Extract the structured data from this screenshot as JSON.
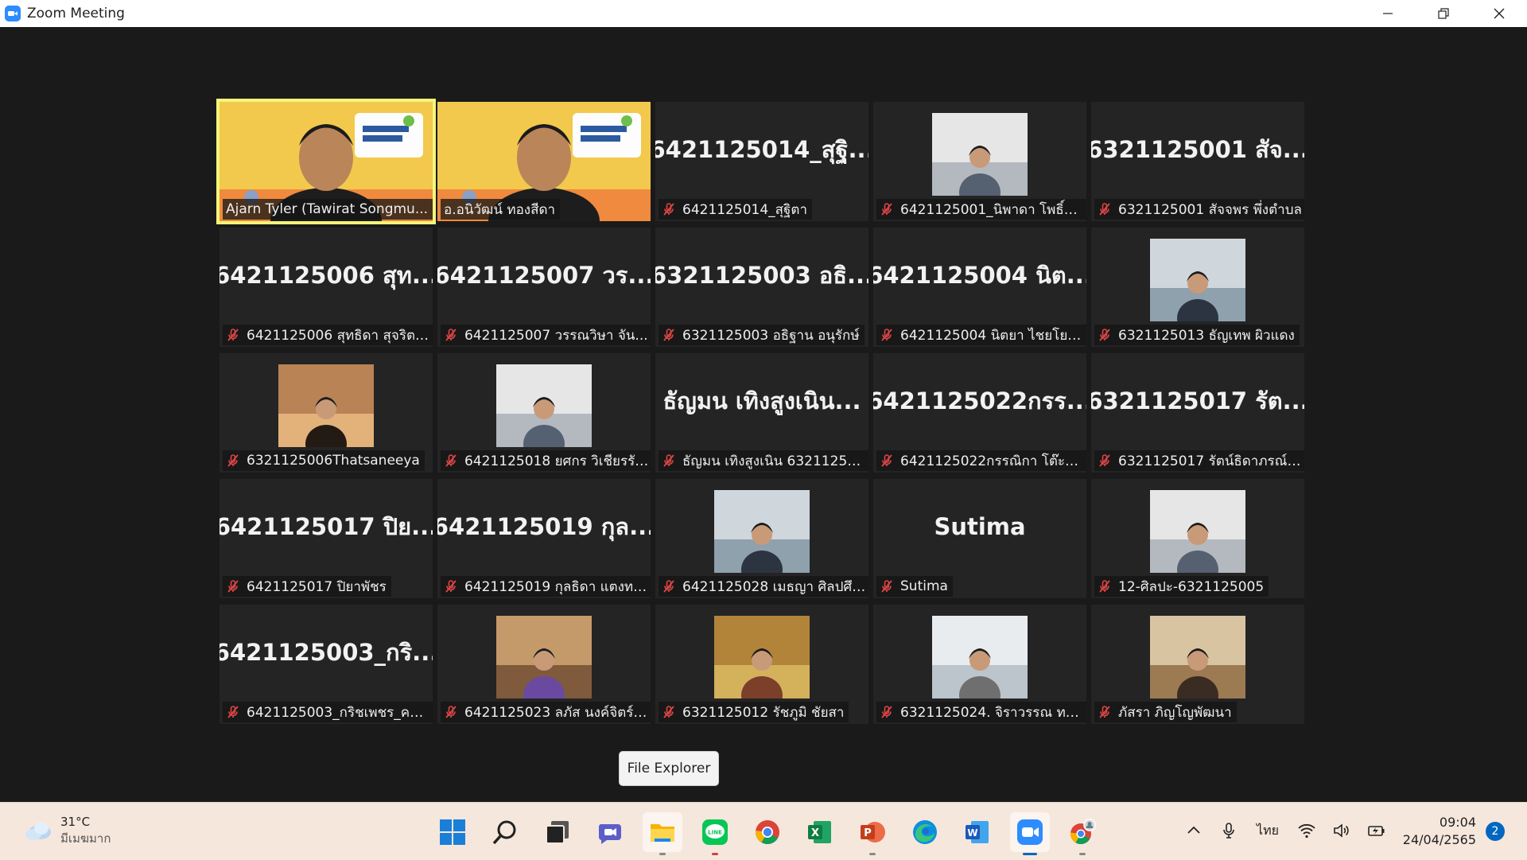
{
  "window": {
    "title": "Zoom Meeting",
    "controls": [
      "minimize",
      "restore",
      "close"
    ]
  },
  "participants": [
    {
      "name_tile": "",
      "label": "Ajarn Tyler (Tawirat Songmu...",
      "video": "camera",
      "speaking": true,
      "muted": false
    },
    {
      "name_tile": "",
      "label": "อ.อนิวัฒน์ ทองสีดา",
      "video": "camera",
      "speaking": false,
      "muted": false
    },
    {
      "name_tile": "6421125014_สุฐิ...",
      "label": "6421125014_สุฐิตา",
      "video": "off",
      "muted": true
    },
    {
      "name_tile": "",
      "label": "6421125001_นิพาดา โพธิ์บุ...",
      "video": "photo",
      "muted": true
    },
    {
      "name_tile": "6321125001 สัจ...",
      "label": "6321125001 สัจจพร พึ่งตำบล",
      "video": "off",
      "muted": true
    },
    {
      "name_tile": "6421125006 สุท...",
      "label": "6421125006 สุทธิดา สุจริต ...",
      "video": "off",
      "muted": true
    },
    {
      "name_tile": "6421125007 วร...",
      "label": "6421125007 วรรณวิษา  จัน...",
      "video": "off",
      "muted": true
    },
    {
      "name_tile": "6321125003 อธิ...",
      "label": "6321125003 อธิฐาน อนุรักษ์",
      "video": "off",
      "muted": true
    },
    {
      "name_tile": "6421125004 นิต...",
      "label": "6421125004 นิตยา ไชยโย ศี...",
      "video": "off",
      "muted": true
    },
    {
      "name_tile": "",
      "label": "6321125013 ธัญเทพ ผิวแดง",
      "video": "photo",
      "muted": true
    },
    {
      "name_tile": "",
      "label": "6321125006Thatsaneeya",
      "video": "photo",
      "muted": true
    },
    {
      "name_tile": "",
      "label": "6421125018 ยศกร วิเชียรรัตน์",
      "video": "photo",
      "muted": true
    },
    {
      "name_tile": "ธัญมน เทิงสูงเนิน...",
      "label": "ธัญมน เทิงสูงเนิน 6321125022",
      "video": "off",
      "muted": true
    },
    {
      "name_tile": "6421125022กรร...",
      "label": "6421125022กรรณิกา โต๊ะห...",
      "video": "off",
      "muted": true
    },
    {
      "name_tile": "6321125017  รัต...",
      "label": "6321125017  รัตน์ธิดาภรณ์ ...",
      "video": "off",
      "muted": true
    },
    {
      "name_tile": "6421125017 ปิย...",
      "label": "6421125017 ปิยาพัชร",
      "video": "off",
      "muted": true
    },
    {
      "name_tile": "6421125019 กุล...",
      "label": "6421125019 กุลธิดา แตงทรั...",
      "video": "off",
      "muted": true
    },
    {
      "name_tile": "",
      "label": "6421125028 เมธญา ศิลปศึก...",
      "video": "photo",
      "muted": true
    },
    {
      "name_tile": "Sutima",
      "label": "Sutima",
      "video": "off",
      "muted": true
    },
    {
      "name_tile": "",
      "label": "12-ศิลปะ-6321125005",
      "video": "photo",
      "muted": true
    },
    {
      "name_tile": "6421125003_กริ...",
      "label": "6421125003_กริชเพชร_คช...",
      "video": "off",
      "muted": true
    },
    {
      "name_tile": "",
      "label": "6421125023 ลภัส นงค์จิตร์ ศ...",
      "video": "photo",
      "muted": true
    },
    {
      "name_tile": "",
      "label": "6321125012 รัชภูมิ ชัยสา",
      "video": "photo",
      "muted": true
    },
    {
      "name_tile": "",
      "label": "6321125024. จิราวรรณ ทอง...",
      "video": "photo",
      "muted": true
    },
    {
      "name_tile": "",
      "label": "ภัสรา ภิญโญพัฒนา",
      "video": "photo",
      "muted": true
    }
  ],
  "tooltip": {
    "text": "File Explorer"
  },
  "taskbar": {
    "weather": {
      "temp": "31°C",
      "condition": "มีเมฆมาก"
    },
    "apps": [
      "windows-start-icon",
      "search-icon",
      "task-view-icon",
      "teams-chat-icon",
      "file-explorer-icon",
      "line-icon",
      "chrome-icon",
      "excel-icon",
      "powerpoint-icon",
      "edge-icon",
      "word-icon",
      "zoom-icon",
      "chrome-profile-icon"
    ],
    "tray": {
      "language": "ไทย"
    },
    "clock": {
      "time": "09:04",
      "date": "24/04/2565"
    },
    "notifications": "2"
  },
  "colors": {
    "speaking_outline": "#f4f57a",
    "muted_mic": "#e04646",
    "zoom_blue": "#2d8cff"
  }
}
